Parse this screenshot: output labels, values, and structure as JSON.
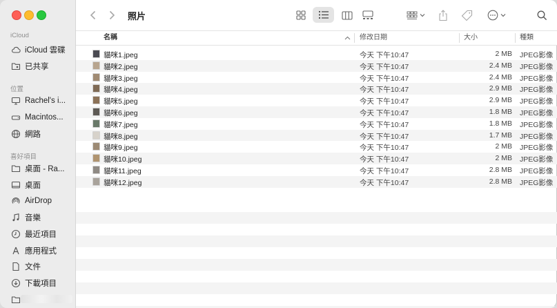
{
  "window": {
    "title": "照片"
  },
  "sidebar": {
    "sections": [
      {
        "label": "iCloud"
      },
      {
        "label": "位置"
      },
      {
        "label": "喜好項目"
      }
    ],
    "items": [
      {
        "label": "iCloud 雲碟",
        "icon": "cloud-icon"
      },
      {
        "label": "已共享",
        "icon": "shared-folder-icon"
      },
      {
        "label": "Rachel's i...",
        "icon": "computer-icon"
      },
      {
        "label": "Macintos...",
        "icon": "disk-icon"
      },
      {
        "label": "網路",
        "icon": "globe-icon"
      },
      {
        "label": "桌面 - Ra...",
        "icon": "folder-icon"
      },
      {
        "label": "桌面",
        "icon": "desktop-icon"
      },
      {
        "label": "AirDrop",
        "icon": "airdrop-icon"
      },
      {
        "label": "音樂",
        "icon": "music-icon"
      },
      {
        "label": "最近項目",
        "icon": "clock-icon"
      },
      {
        "label": "應用程式",
        "icon": "apps-icon"
      },
      {
        "label": "文件",
        "icon": "document-icon"
      },
      {
        "label": "下載項目",
        "icon": "download-icon"
      }
    ]
  },
  "columns": {
    "name": "名稱",
    "date": "修改日期",
    "size": "大小",
    "kind": "種類"
  },
  "files": [
    {
      "name": "貓咪1.jpeg",
      "date": "今天 下午10:47",
      "size": "2 MB",
      "kind": "JPEG影像"
    },
    {
      "name": "貓咪2.jpeg",
      "date": "今天 下午10:47",
      "size": "2.4 MB",
      "kind": "JPEG影像"
    },
    {
      "name": "貓咪3.jpeg",
      "date": "今天 下午10:47",
      "size": "2.4 MB",
      "kind": "JPEG影像"
    },
    {
      "name": "貓咪4.jpeg",
      "date": "今天 下午10:47",
      "size": "2.9 MB",
      "kind": "JPEG影像"
    },
    {
      "name": "貓咪5.jpeg",
      "date": "今天 下午10:47",
      "size": "2.9 MB",
      "kind": "JPEG影像"
    },
    {
      "name": "貓咪6.jpeg",
      "date": "今天 下午10:47",
      "size": "1.8 MB",
      "kind": "JPEG影像"
    },
    {
      "name": "貓咪7.jpeg",
      "date": "今天 下午10:47",
      "size": "1.8 MB",
      "kind": "JPEG影像"
    },
    {
      "name": "貓咪8.jpeg",
      "date": "今天 下午10:47",
      "size": "1.7 MB",
      "kind": "JPEG影像"
    },
    {
      "name": "貓咪9.jpeg",
      "date": "今天 下午10:47",
      "size": "2 MB",
      "kind": "JPEG影像"
    },
    {
      "name": "貓咪10.jpeg",
      "date": "今天 下午10:47",
      "size": "2 MB",
      "kind": "JPEG影像"
    },
    {
      "name": "貓咪11.jpeg",
      "date": "今天 下午10:47",
      "size": "2.8 MB",
      "kind": "JPEG影像"
    },
    {
      "name": "貓咪12.jpeg",
      "date": "今天 下午10:47",
      "size": "2.8 MB",
      "kind": "JPEG影像"
    }
  ],
  "colors": {
    "accent": "#007aff",
    "sidebar_bg": "#ececec",
    "row_alt": "#f4f4f4"
  }
}
